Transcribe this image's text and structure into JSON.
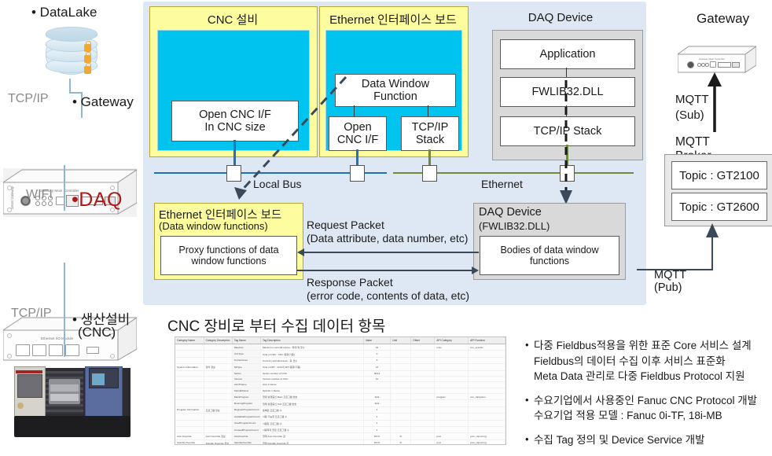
{
  "left_column": {
    "datalake_label": "• DataLake",
    "link1_label": "TCP/IP",
    "gateway_label": "• Gateway",
    "gateway_device_caption": "Gateway Main Controller",
    "gateway_device_side_caption": "Smart Gateway",
    "link2_label": "WIFI",
    "daq_label": "•DAQ",
    "io_device_caption": "Ethernet I/O Module",
    "link3_label": "TCP/IP",
    "cnc_label_line1": "• 생산설비",
    "cnc_label_line2": "(CNC)"
  },
  "main_panel": {
    "cnc_group_title": "CNC 설비",
    "eth_group_title": "Ethernet 인터페이스 보드",
    "open_cnc_if_box": "Open CNC I/F\nIn CNC size",
    "data_window_function_box": "Data Window\nFunction",
    "open_cnc_if_small_box": "Open\nCNC I/F",
    "tcpip_stack_small_box": "TCP/IP\nStack",
    "local_bus_label": "Local Bus",
    "ethernet_label": "Ethernet",
    "daq_device_title": "DAQ Device",
    "daq_application": "Application",
    "daq_fwlib": "FWLIB32.DLL",
    "daq_tcpip_stack": "TCP/IP Stack",
    "eth_board_lower_title": "Ethernet 인터페이스 보드",
    "eth_board_lower_sub": "(Data window functions)",
    "proxy_box": "Proxy functions of data\nwindow functions",
    "request_packet_line1": "Request Packet",
    "request_packet_line2": "(Data attribute, data number, etc)",
    "response_packet_line1": "Response Packet",
    "response_packet_line2": "(error code, contents of data, etc)",
    "daq_lower_title": "DAQ Device",
    "daq_lower_sub": "(FWLIB32.DLL)",
    "bodies_box": "Bodies of data window\nfunctions"
  },
  "right_column": {
    "gateway_title": "Gateway",
    "gateway_device_caption": "Gateway Main Controller",
    "mqtt_sub_line1": "MQTT",
    "mqtt_sub_line2": "(Sub)",
    "mqtt_broker_title": "MQTT Broker",
    "topics": [
      "Topic : GT2100",
      "Topic : GT2600"
    ],
    "mqtt_pub_label": "MQTT (Pub)"
  },
  "bottom": {
    "title": "CNC 장비로 부터 수집 데이터 항목",
    "bullets": [
      [
        "다중 Fieldbus적용을 위한 표준 Core 서비스 설계",
        "Fieldbus의 데이터 수집 이후 서비스 표준화",
        "Meta Data 관리로 다중 Fieldbus Protocol 지원"
      ],
      [
        "수요기업에서 사용중인 Fanuc CNC Protocol 개발",
        "수요기업 적용 모델 : Fanuc 0i-TF, 18i-MB"
      ],
      [
        "수집 Tag 정의 및 Device Service 개발"
      ]
    ]
  },
  "table": {
    "columns": [
      "Category Name",
      "Category Description",
      "Tag Name",
      "Tag Description",
      "Value",
      "Unit",
      "Offset",
      "API Category",
      "API Function"
    ],
    "rows": [
      [
        "",
        "",
        "MaxAxis",
        "Maximum controlled axes : 최대 축 갯수",
        "32",
        "",
        "",
        "misc",
        "cnc_sysinfo"
      ],
      [
        "",
        "",
        "CncType",
        "Kind of CNC : CNC 종류(기종)",
        "0",
        "",
        "",
        "",
        ""
      ],
      [
        "",
        "",
        "CurrentAxes",
        "Current controlled axes : 축 갯수",
        "3",
        "",
        "",
        "",
        ""
      ],
      [
        "System Information",
        "장비 정보",
        "MtType",
        "Kind of M/T : CNC의 M/T 종류(기종)",
        "M",
        "",
        "",
        "",
        ""
      ],
      [
        "",
        "",
        "Series",
        "Series number of CNC",
        "0i411",
        "",
        "",
        "",
        ""
      ],
      [
        "",
        "",
        "Version",
        "Version number of CNC",
        "31",
        "",
        "",
        "",
        ""
      ],
      [
        "",
        "",
        "AxisTName",
        "Axis 1 Name",
        "",
        "",
        "",
        "",
        ""
      ],
      [
        "",
        "",
        "SpindleName",
        "Spindle 1 Name",
        "",
        "",
        "",
        "",
        ""
      ],
      [
        "",
        "",
        "MainProgram",
        "현재 실행중인 Main 프로그램 번호",
        "1111",
        "",
        "",
        "program",
        "cnc_rdprgnum"
      ],
      [
        "",
        "",
        "RunningProgram",
        "현재 실행중인 Sub 프로그램 번호",
        "1111",
        "",
        "",
        "",
        ""
      ],
      [
        "Program Information",
        "프로그램 정보",
        "RegisterProgramCount",
        "등록된 프로그램 수",
        "1",
        "",
        "",
        "",
        ""
      ],
      [
        "",
        "",
        "AvailableProgramCount",
        "사용 가능한 프로그램 수",
        "1",
        "",
        "",
        "",
        ""
      ],
      [
        "",
        "",
        "UsedProgramCount",
        "사용된 프로그램 수",
        "1",
        "",
        "",
        "",
        ""
      ],
      [
        "",
        "",
        "UnusedProgramCount",
        "사용하지 않은 프로그램 수",
        "1",
        "",
        "",
        "",
        ""
      ],
      [
        "Axis Override",
        "Axis Override 정보",
        "AxisOverride",
        "현재 Axis Override 값",
        "80 %",
        "%",
        "",
        "pmc",
        "pmc_rdpmcrng"
      ],
      [
        "Spindle Override",
        "Spindle Override 정보",
        "SpindleOverride",
        "현재 Spindle Override 값",
        "80 %",
        "%",
        "",
        "pmc",
        "pmc_rdpmcrng"
      ]
    ]
  },
  "colors": {
    "panel_bg": "#dee7f4",
    "yellow": "#fdfda0",
    "cyan": "#00c4f0",
    "gray_box": "#d9d9d9",
    "bus_blue": "#1f72b8",
    "bus_green": "#6e8b3d",
    "daq_red": "#b01818"
  }
}
